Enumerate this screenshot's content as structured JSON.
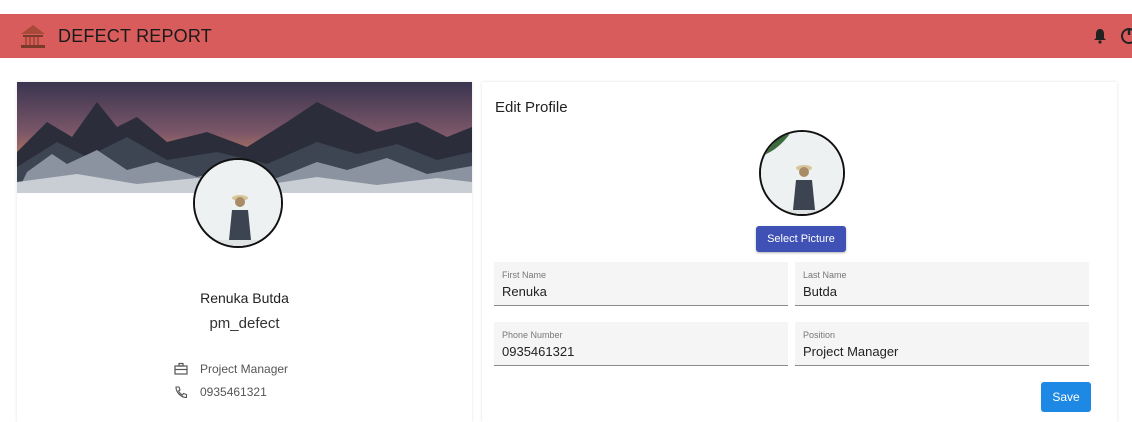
{
  "app": {
    "title": "DEFECT REPORT"
  },
  "header": {
    "logo_icon": "building-icon",
    "notification_icon": "bell-icon",
    "power_icon": "power-icon",
    "bar_color": "#d95c5c"
  },
  "profile_card": {
    "full_name": "Renuka Butda",
    "username": "pm_defect",
    "position": "Project Manager",
    "phone": "0935461321",
    "position_icon": "briefcase-icon",
    "phone_icon": "phone-icon"
  },
  "edit_profile": {
    "title": "Edit Profile",
    "select_picture_label": "Select Picture",
    "fields": {
      "first_name": {
        "label": "First Name",
        "value": "Renuka"
      },
      "last_name": {
        "label": "Last Name",
        "value": "Butda"
      },
      "phone_number": {
        "label": "Phone Number",
        "value": "0935461321"
      },
      "position": {
        "label": "Position",
        "value": "Project Manager"
      }
    },
    "save_label": "Save"
  },
  "colors": {
    "primary_button": "#3f51b5",
    "save_button": "#1e88e5"
  }
}
